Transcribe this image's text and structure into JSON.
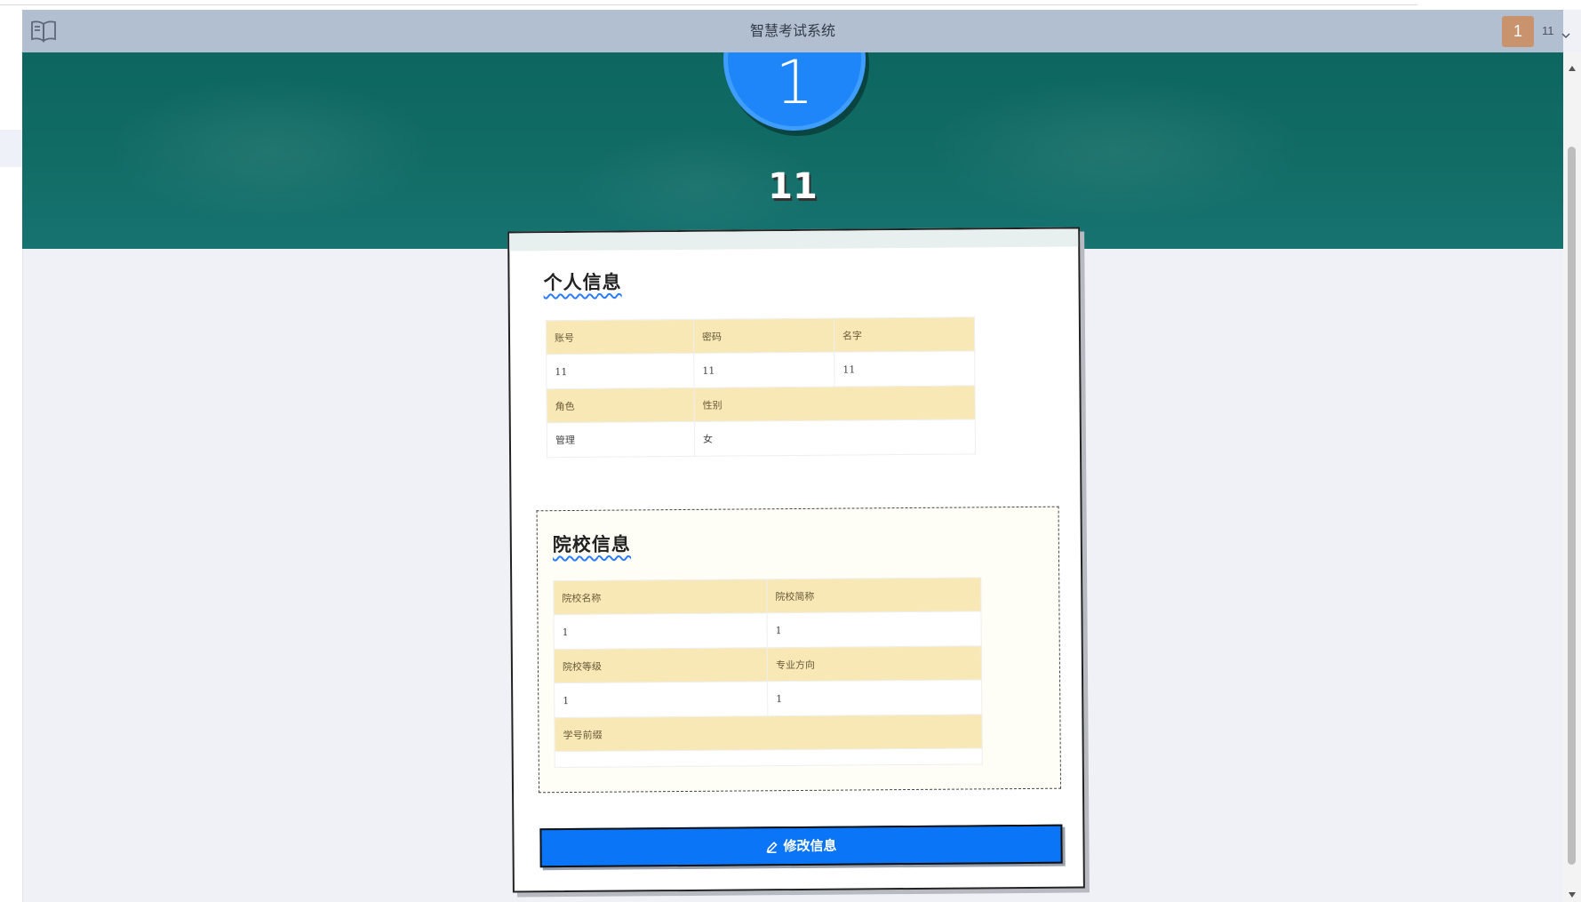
{
  "app": {
    "title": "智慧考试系统",
    "user": {
      "avatar_text": "1",
      "name": "11"
    }
  },
  "icons": [
    "book-icon",
    "chevron-down-icon",
    "pencil-icon",
    "scroll-up-arrow-icon",
    "scroll-down-arrow-icon"
  ],
  "colors": {
    "accent": "#0a75f6",
    "topbar": "#b2bfd1",
    "hero": "#126c66",
    "table_header": "#f7e8b5",
    "avatar_bg": "#c9936d"
  },
  "profile": {
    "avatar_text": "1",
    "display_name": "11"
  },
  "personal": {
    "title": "个人信息",
    "headers_row1": [
      "账号",
      "密码",
      "名字"
    ],
    "values_row1": [
      "11",
      "11",
      "11"
    ],
    "headers_row2": [
      "角色",
      "性别"
    ],
    "values_row2": [
      "管理",
      "女"
    ]
  },
  "school": {
    "title": "院校信息",
    "headers_row1": [
      "院校名称",
      "院校简称"
    ],
    "values_row1": [
      "1",
      "1"
    ],
    "headers_row2": [
      "院校等级",
      "专业方向"
    ],
    "values_row2": [
      "1",
      "1"
    ],
    "headers_row3": [
      "学号前缀"
    ],
    "values_row3": [
      ""
    ]
  },
  "actions": {
    "edit_label": "修改信息"
  }
}
